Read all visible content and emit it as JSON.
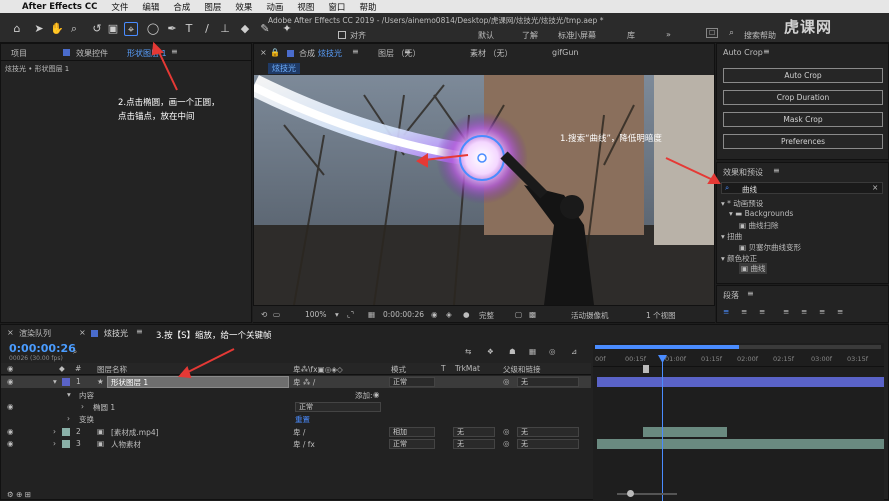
{
  "menubar": {
    "app_name": "After Effects CC",
    "items": [
      "文件",
      "编辑",
      "合成",
      "图层",
      "效果",
      "动画",
      "视图",
      "窗口",
      "帮助"
    ]
  },
  "window_title": "Adobe After Effects CC 2019 - /Users/ainemo0814/Desktop/虎课网/炫技光/炫技光/tmp.aep *",
  "toolbar": {
    "align_label": "对齐",
    "workspaces": [
      "默认",
      "了解",
      "标准",
      "小屏幕",
      "库"
    ],
    "search_help": "搜索帮助"
  },
  "watermark": "虎课网",
  "project_panel": {
    "tabs": [
      "项目",
      "效果控件"
    ],
    "effect_controls_target": "形状图层 1",
    "breadcrumb": "炫技光 • 形状图层 1"
  },
  "comp_panel": {
    "tab_prefix": "合成",
    "tab_name": "炫技光",
    "other_tabs": [
      "图层 （无）",
      "素材 （无）",
      "gifGun"
    ],
    "comp_label": "炫技光",
    "zoom": "100%",
    "timecode": "0:00:00:26",
    "quality": "完整",
    "camera": "活动摄像机",
    "views": "1 个视图"
  },
  "annotations": {
    "step1": "1.搜索“曲线”，降低明暗度",
    "step2_line1": "2.点击椭圆，画一个正圆，",
    "step2_line2": "点击锚点，放在中间",
    "step3": "3.按【S】缩放，给一个关键帧"
  },
  "autocrop": {
    "title": "Auto Crop",
    "buttons": [
      "Auto Crop",
      "Crop Duration",
      "Mask Crop",
      "Preferences"
    ]
  },
  "effects_panel": {
    "title": "效果和预设",
    "search_value": "曲线",
    "tree": [
      {
        "label": "* 动画预设",
        "level": 0
      },
      {
        "label": "Backgrounds",
        "level": 1
      },
      {
        "label": "曲线扫除",
        "level": 2
      },
      {
        "label": "扭曲",
        "level": 0
      },
      {
        "label": "贝塞尔曲线变形",
        "level": 2
      },
      {
        "label": "颜色校正",
        "level": 0
      },
      {
        "label": "曲线",
        "level": 2
      }
    ]
  },
  "paragraph_panel": {
    "title": "段落"
  },
  "timeline": {
    "tabs": [
      "渲染队列",
      "炫技光"
    ],
    "timecode": "0:00:00:26",
    "frame_info": "00026 (30.00 fps)",
    "columns": {
      "name": "图层名称",
      "mode": "模式",
      "t": "T",
      "trkmat": "TrkMat",
      "parent": "父级和链接"
    },
    "ruler": [
      "00f",
      "00:15f",
      "01:00f",
      "01:15f",
      "02:00f",
      "02:15f",
      "03:00f",
      "03:15f"
    ],
    "layers": [
      {
        "num": "1",
        "name": "形状图层 1",
        "mode": "正常",
        "trkmat": "",
        "parent": "无"
      },
      {
        "num": "2",
        "name": "[素材成.mp4]",
        "mode": "相加",
        "trkmat": "无",
        "parent": "无"
      },
      {
        "num": "3",
        "name": "人物素材",
        "mode": "正常",
        "trkmat": "无",
        "parent": "无"
      }
    ],
    "sub_rows": {
      "content": "内容",
      "add": "添加:",
      "ellipse": "椭圆 1",
      "ellipse_mode": "正常",
      "transform": "变换",
      "reset": "重置"
    }
  },
  "colors": {
    "accent": "#4a8cff",
    "timecode": "#4a9cff",
    "layer_bar": "#5a63c8",
    "footage_bar": "#6a8a80",
    "annotation_arrow": "#e53935"
  }
}
